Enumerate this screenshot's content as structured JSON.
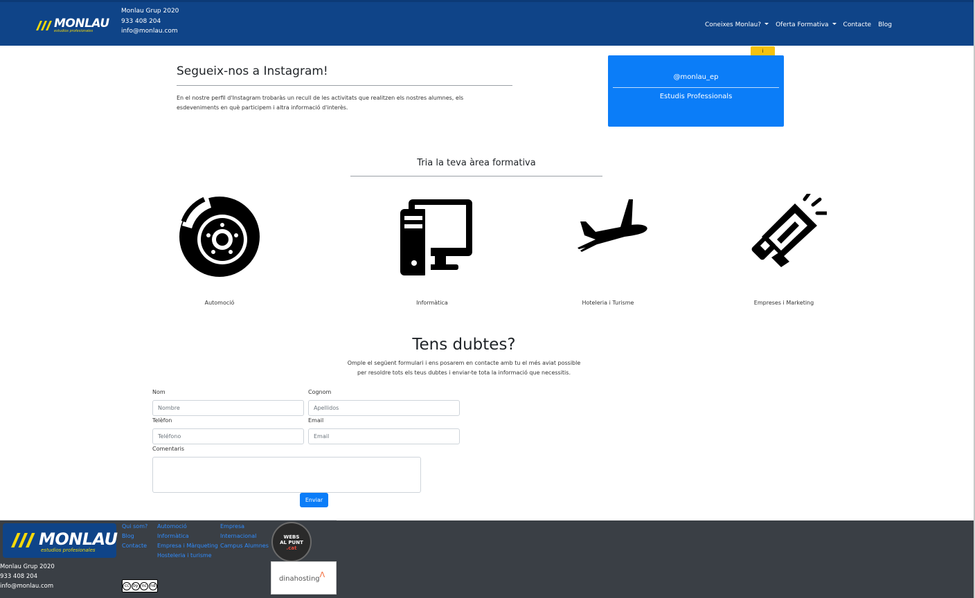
{
  "header": {
    "company": "Monlau Grup 2020",
    "phone": "933 408 204",
    "email": "info@monlau.com",
    "logo_text": "MONLAU",
    "logo_subtext": "estudios profesionales",
    "nav": [
      "Coneixes Monlau?",
      "Oferta Formativa",
      "Contacte",
      "Blog"
    ]
  },
  "instagram": {
    "title": "Segueix-nos a Instagram!",
    "text": "En el nostre perfil d'Instagram trobaràs un recull de les activitats que realitzen els nostres alumnes, els esdeveniments en què participem i altra informació d'interès.",
    "tab": "i",
    "handle": "@monlau_ep",
    "subtitle": "Estudis Professionals"
  },
  "areas": {
    "title": "Tria la teva àrea formativa",
    "items": [
      {
        "label": "Automoció",
        "icon": "brake-disc-icon"
      },
      {
        "label": "Informàtica",
        "icon": "desktop-computer-icon"
      },
      {
        "label": "Hoteleria i Turisme",
        "icon": "airplane-icon"
      },
      {
        "label": "Empreses i Marketing",
        "icon": "megaphone-icon"
      }
    ]
  },
  "form": {
    "title": "Tens dubtes?",
    "intro_line1": "Omple el següent formulari i ens posarem en contacte amb tu el més aviat possible",
    "intro_line2": "per resoldre tots els teus dubtes i enviar-te tota la informació que necessitis.",
    "fields": {
      "name_label": "Nom",
      "name_placeholder": "Nombre",
      "surname_label": "Cognom",
      "surname_placeholder": "Apellidos",
      "phone_label": "Telèfon",
      "phone_placeholder": "Teléfono",
      "email_label": "Email",
      "email_placeholder": "Email",
      "comments_label": "Comentaris"
    },
    "submit": "Enviar"
  },
  "footer": {
    "logo_text": "MONLAU",
    "logo_subtext": "estudios profesionales",
    "company": "Monlau Grup 2020",
    "phone": "933 408 204",
    "email": "info@monlau.com",
    "links_col1": [
      "Qui som?",
      "Blog",
      "Contacte"
    ],
    "links_col2": [
      "Automoció",
      "Informàtica",
      "Empresa i Màrqueting",
      "Hosteleria i turisme"
    ],
    "links_col3": [
      "Empresa",
      "Internacional",
      "Campus Alumnes"
    ],
    "webs_badge": [
      "WEBS",
      "AL PUNT",
      ".cat"
    ],
    "dina": "dinahosting",
    "cc_icons": [
      "cc",
      "by",
      "nc",
      "nd"
    ]
  },
  "colors": {
    "header_bg": "#0f4488",
    "accent_blue": "#0b7df8",
    "footer_bg": "#3a3f45",
    "logo_yellow": "#f5d90a",
    "tab_yellow": "#f6c20f"
  }
}
